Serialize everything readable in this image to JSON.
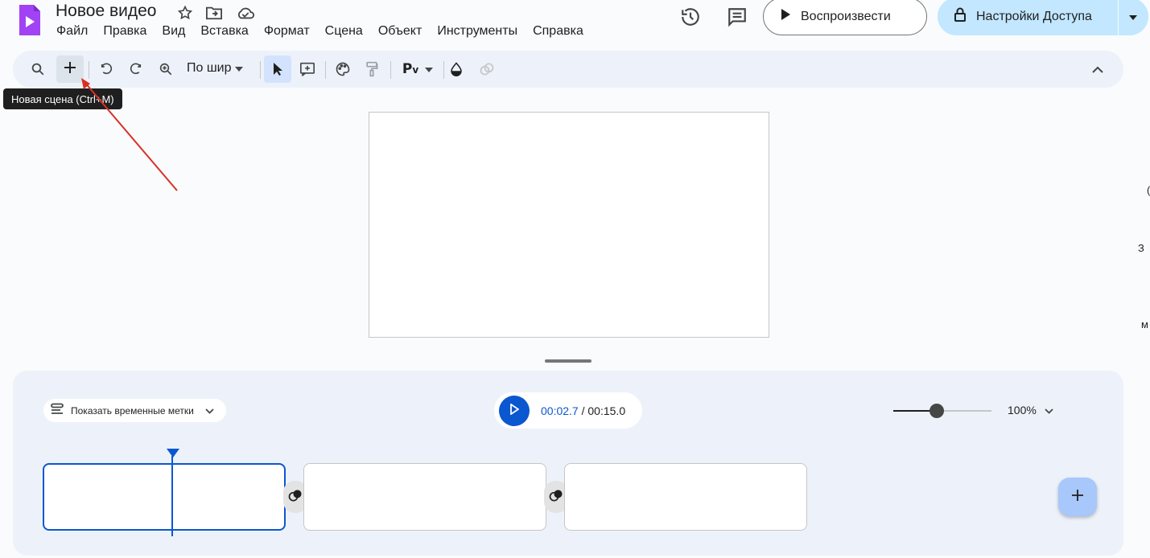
{
  "header": {
    "doc_title": "Новое видео",
    "menu": [
      "Файл",
      "Правка",
      "Вид",
      "Вставка",
      "Формат",
      "Сцена",
      "Объект",
      "Инструменты",
      "Справка"
    ],
    "play_label": "Воспроизвести",
    "share_label": "Настройки Доступа"
  },
  "toolbar": {
    "zoom_value": "По шир",
    "tooltip": "Новая сцена (Ctrl+M)"
  },
  "side_panel": {
    "fragments": [
      "З",
      "м",
      "("
    ]
  },
  "timeline": {
    "timestamps_label": "Показать временные метки",
    "current_time": "00:02.7",
    "separator": " / ",
    "total_time": "00:15.0",
    "zoom_percent": "100%",
    "zoom_level": 0.44,
    "scene_count": 3
  },
  "colors": {
    "accent": "#0b57d0",
    "share_bg": "#c2e7ff",
    "app_logo": "#a142f4",
    "annotation_arrow": "#d93025"
  }
}
